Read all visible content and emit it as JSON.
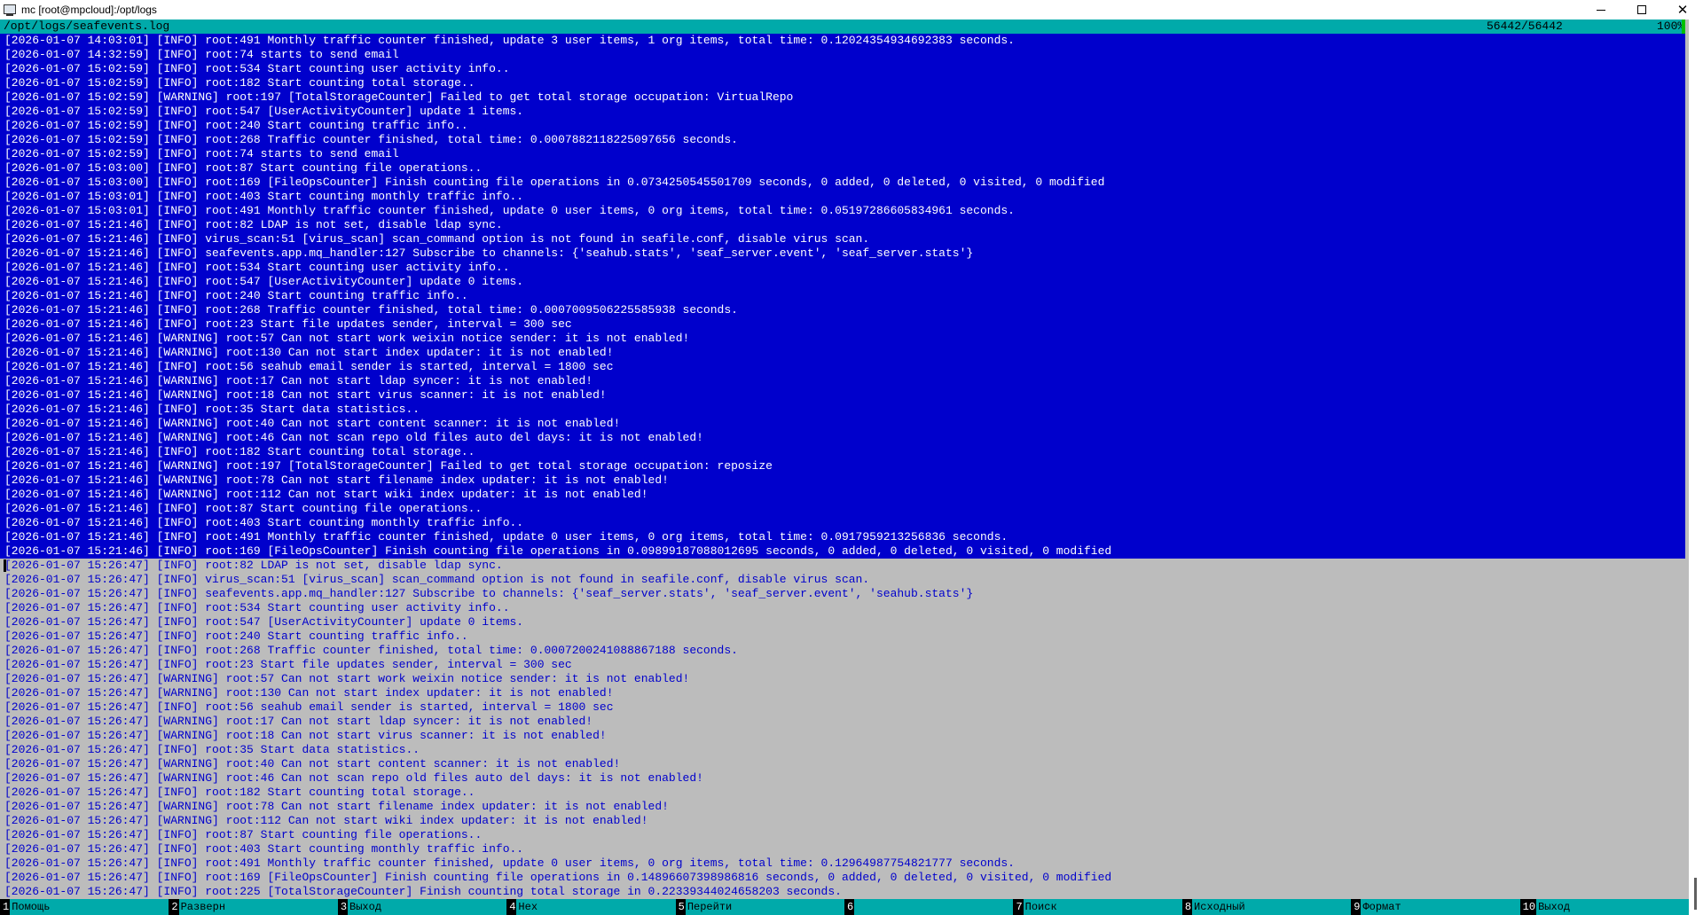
{
  "window": {
    "title": "mc [root@mpcloud]:/opt/logs",
    "minimize_label": "",
    "restore_label": "",
    "close_label": "✕"
  },
  "viewer": {
    "file_path": "/opt/logs/seafevents.log",
    "position": "56442/56442",
    "percent": "100%",
    "selected_line_count": 37,
    "lines": [
      "[2026-01-07 14:03:01] [INFO] root:491 Monthly traffic counter finished, update 3 user items, 1 org items, total time: 0.12024354934692383 seconds.",
      "[2026-01-07 14:32:59] [INFO] root:74 starts to send email",
      "[2026-01-07 15:02:59] [INFO] root:534 Start counting user activity info..",
      "[2026-01-07 15:02:59] [INFO] root:182 Start counting total storage..",
      "[2026-01-07 15:02:59] [WARNING] root:197 [TotalStorageCounter] Failed to get total storage occupation: VirtualRepo",
      "[2026-01-07 15:02:59] [INFO] root:547 [UserActivityCounter] update 1 items.",
      "[2026-01-07 15:02:59] [INFO] root:240 Start counting traffic info..",
      "[2026-01-07 15:02:59] [INFO] root:268 Traffic counter finished, total time: 0.0007882118225097656 seconds.",
      "[2026-01-07 15:02:59] [INFO] root:74 starts to send email",
      "[2026-01-07 15:03:00] [INFO] root:87 Start counting file operations..",
      "[2026-01-07 15:03:00] [INFO] root:169 [FileOpsCounter] Finish counting file operations in 0.0734250545501709 seconds, 0 added, 0 deleted, 0 visited, 0 modified",
      "[2026-01-07 15:03:01] [INFO] root:403 Start counting monthly traffic info..",
      "[2026-01-07 15:03:01] [INFO] root:491 Monthly traffic counter finished, update 0 user items, 0 org items, total time: 0.05197286605834961 seconds.",
      "[2026-01-07 15:21:46] [INFO] root:82 LDAP is not set, disable ldap sync.",
      "[2026-01-07 15:21:46] [INFO] virus_scan:51 [virus_scan] scan_command option is not found in seafile.conf, disable virus scan.",
      "[2026-01-07 15:21:46] [INFO] seafevents.app.mq_handler:127 Subscribe to channels: {'seahub.stats', 'seaf_server.event', 'seaf_server.stats'}",
      "[2026-01-07 15:21:46] [INFO] root:534 Start counting user activity info..",
      "[2026-01-07 15:21:46] [INFO] root:547 [UserActivityCounter] update 0 items.",
      "[2026-01-07 15:21:46] [INFO] root:240 Start counting traffic info..",
      "[2026-01-07 15:21:46] [INFO] root:268 Traffic counter finished, total time: 0.0007009506225585938 seconds.",
      "[2026-01-07 15:21:46] [INFO] root:23 Start file updates sender, interval = 300 sec",
      "[2026-01-07 15:21:46] [WARNING] root:57 Can not start work weixin notice sender: it is not enabled!",
      "[2026-01-07 15:21:46] [WARNING] root:130 Can not start index updater: it is not enabled!",
      "[2026-01-07 15:21:46] [INFO] root:56 seahub email sender is started, interval = 1800 sec",
      "[2026-01-07 15:21:46] [WARNING] root:17 Can not start ldap syncer: it is not enabled!",
      "[2026-01-07 15:21:46] [WARNING] root:18 Can not start virus scanner: it is not enabled!",
      "[2026-01-07 15:21:46] [INFO] root:35 Start data statistics..",
      "[2026-01-07 15:21:46] [WARNING] root:40 Can not start content scanner: it is not enabled!",
      "[2026-01-07 15:21:46] [WARNING] root:46 Can not scan repo old files auto del days: it is not enabled!",
      "[2026-01-07 15:21:46] [INFO] root:182 Start counting total storage..",
      "[2026-01-07 15:21:46] [WARNING] root:197 [TotalStorageCounter] Failed to get total storage occupation: reposize",
      "[2026-01-07 15:21:46] [WARNING] root:78 Can not start filename index updater: it is not enabled!",
      "[2026-01-07 15:21:46] [WARNING] root:112 Can not start wiki index updater: it is not enabled!",
      "[2026-01-07 15:21:46] [INFO] root:87 Start counting file operations..",
      "[2026-01-07 15:21:46] [INFO] root:403 Start counting monthly traffic info..",
      "[2026-01-07 15:21:46] [INFO] root:491 Monthly traffic counter finished, update 0 user items, 0 org items, total time: 0.0917959213256836 seconds.",
      "[2026-01-07 15:21:46] [INFO] root:169 [FileOpsCounter] Finish counting file operations in 0.09899187088012695 seconds, 0 added, 0 deleted, 0 visited, 0 modified",
      "[2026-01-07 15:26:47] [INFO] root:82 LDAP is not set, disable ldap sync.",
      "[2026-01-07 15:26:47] [INFO] virus_scan:51 [virus_scan] scan_command option is not found in seafile.conf, disable virus scan.",
      "[2026-01-07 15:26:47] [INFO] seafevents.app.mq_handler:127 Subscribe to channels: {'seaf_server.stats', 'seaf_server.event', 'seahub.stats'}",
      "[2026-01-07 15:26:47] [INFO] root:534 Start counting user activity info..",
      "[2026-01-07 15:26:47] [INFO] root:547 [UserActivityCounter] update 0 items.",
      "[2026-01-07 15:26:47] [INFO] root:240 Start counting traffic info..",
      "[2026-01-07 15:26:47] [INFO] root:268 Traffic counter finished, total time: 0.0007200241088867188 seconds.",
      "[2026-01-07 15:26:47] [INFO] root:23 Start file updates sender, interval = 300 sec",
      "[2026-01-07 15:26:47] [WARNING] root:57 Can not start work weixin notice sender: it is not enabled!",
      "[2026-01-07 15:26:47] [WARNING] root:130 Can not start index updater: it is not enabled!",
      "[2026-01-07 15:26:47] [INFO] root:56 seahub email sender is started, interval = 1800 sec",
      "[2026-01-07 15:26:47] [WARNING] root:17 Can not start ldap syncer: it is not enabled!",
      "[2026-01-07 15:26:47] [WARNING] root:18 Can not start virus scanner: it is not enabled!",
      "[2026-01-07 15:26:47] [INFO] root:35 Start data statistics..",
      "[2026-01-07 15:26:47] [WARNING] root:40 Can not start content scanner: it is not enabled!",
      "[2026-01-07 15:26:47] [WARNING] root:46 Can not scan repo old files auto del days: it is not enabled!",
      "[2026-01-07 15:26:47] [INFO] root:182 Start counting total storage..",
      "[2026-01-07 15:26:47] [WARNING] root:78 Can not start filename index updater: it is not enabled!",
      "[2026-01-07 15:26:47] [WARNING] root:112 Can not start wiki index updater: it is not enabled!",
      "[2026-01-07 15:26:47] [INFO] root:87 Start counting file operations..",
      "[2026-01-07 15:26:47] [INFO] root:403 Start counting monthly traffic info..",
      "[2026-01-07 15:26:47] [INFO] root:491 Monthly traffic counter finished, update 0 user items, 0 org items, total time: 0.12964987754821777 seconds.",
      "[2026-01-07 15:26:47] [INFO] root:169 [FileOpsCounter] Finish counting file operations in 0.14896607398986816 seconds, 0 added, 0 deleted, 0 visited, 0 modified",
      "[2026-01-07 15:26:47] [INFO] root:225 [TotalStorageCounter] Finish counting total storage in 0.22339344024658203 seconds."
    ]
  },
  "fkeys": [
    {
      "num": "1",
      "label": "Помощь"
    },
    {
      "num": "2",
      "label": "Разверн"
    },
    {
      "num": "3",
      "label": "Выход"
    },
    {
      "num": "4",
      "label": "Hex"
    },
    {
      "num": "5",
      "label": "Перейти"
    },
    {
      "num": "6",
      "label": ""
    },
    {
      "num": "7",
      "label": "Поиск"
    },
    {
      "num": "8",
      "label": "Исходный"
    },
    {
      "num": "9",
      "label": "Формат"
    },
    {
      "num": "10",
      "label": "Выход"
    }
  ],
  "colors": {
    "header_bg": "#00aaaa",
    "selection_bg": "#0000cc",
    "selection_fg": "#ffffff",
    "text_fg": "#0000cc",
    "background": "#bcbcbc"
  },
  "icons": {
    "app": "terminal-icon",
    "minimize": "minimize-icon",
    "restore": "restore-icon",
    "close": "close-icon"
  }
}
